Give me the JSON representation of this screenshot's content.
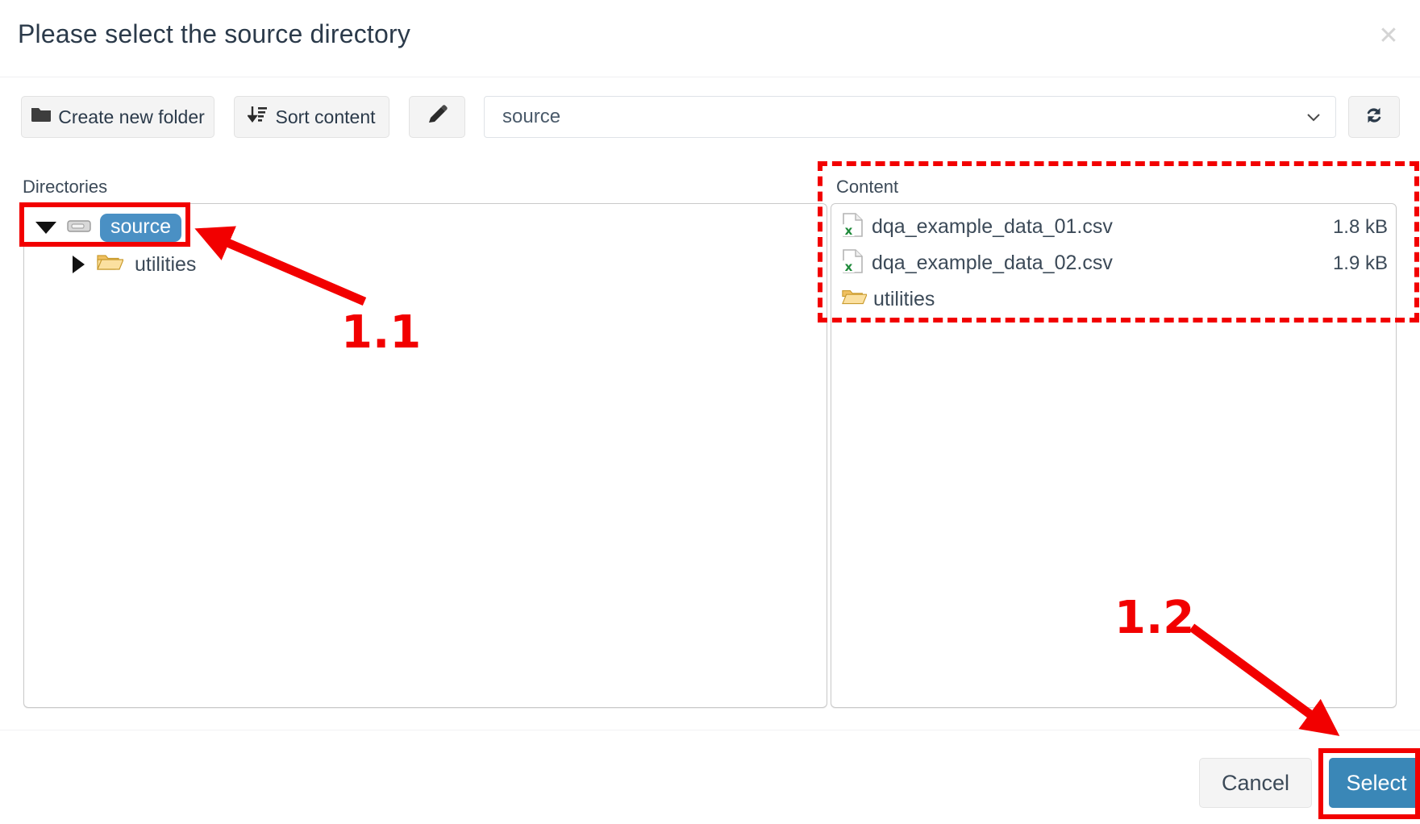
{
  "dialog": {
    "title": "Please select the source directory",
    "close_icon": "close-icon"
  },
  "toolbar": {
    "create_folder_label": "Create new folder",
    "create_folder_icon": "folder-solid-icon",
    "sort_content_label": "Sort content",
    "sort_content_icon": "sort-descending-icon",
    "edit_icon": "pencil-icon",
    "refresh_icon": "refresh-icon",
    "path": {
      "value": "source",
      "caret_icon": "chevron-down-icon"
    }
  },
  "directories": {
    "label": "Directories",
    "tree": [
      {
        "name": "source",
        "icon": "drive-icon",
        "expander": "triangle-down-icon",
        "selected": true
      },
      {
        "name": "utilities",
        "icon": "folder-open-icon",
        "expander": "triangle-right-icon",
        "selected": false
      }
    ]
  },
  "content": {
    "label": "Content",
    "items": [
      {
        "name": "dqa_example_data_01.csv",
        "size": "1.8 kB",
        "icon": "csv-file-icon"
      },
      {
        "name": "dqa_example_data_02.csv",
        "size": "1.9 kB",
        "icon": "csv-file-icon"
      },
      {
        "name": "utilities",
        "size": "",
        "icon": "folder-open-icon"
      }
    ]
  },
  "footer": {
    "cancel_label": "Cancel",
    "select_label": "Select"
  },
  "annotations": {
    "step_one_label": "1.1",
    "step_two_label": "1.2",
    "color": "#f20000"
  },
  "colors": {
    "accent_blue": "#3a87b7",
    "selection_blue": "#4a90c4",
    "annotation_red": "#f20000",
    "text": "#3c4a58"
  }
}
